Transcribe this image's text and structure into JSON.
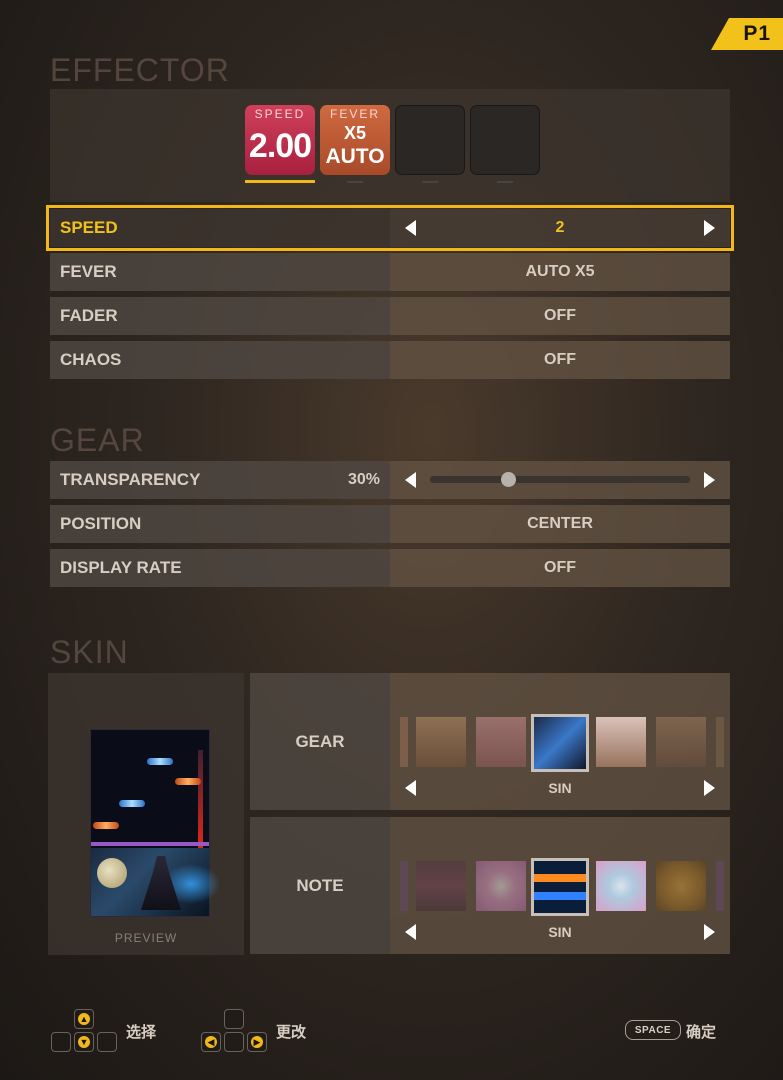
{
  "player_badge": "P1",
  "effector": {
    "title": "EFFECTOR",
    "slots": [
      {
        "top": "SPEED",
        "value": "2.00"
      },
      {
        "top": "FEVER",
        "x5": "X5",
        "auto": "AUTO"
      },
      {},
      {}
    ],
    "rows": [
      {
        "label": "SPEED",
        "value": "2"
      },
      {
        "label": "FEVER",
        "value": "AUTO X5"
      },
      {
        "label": "FADER",
        "value": "OFF"
      },
      {
        "label": "CHAOS",
        "value": "OFF"
      }
    ]
  },
  "gear": {
    "title": "GEAR",
    "transparency": {
      "label": "TRANSPARENCY",
      "value": "30%",
      "level": 0.3
    },
    "position": {
      "label": "POSITION",
      "value": "CENTER"
    },
    "display_rate": {
      "label": "DISPLAY RATE",
      "value": "OFF"
    }
  },
  "skin": {
    "title": "SKIN",
    "preview_label": "PREVIEW",
    "gear": {
      "label": "GEAR",
      "selected": "SIN"
    },
    "note": {
      "label": "NOTE",
      "selected": "SIN"
    }
  },
  "footer": {
    "select": "选择",
    "change": "更改",
    "space_key": "SPACE",
    "confirm": "确定"
  },
  "colors": {
    "accent": "#f2b71a",
    "speed_slot": "#c83050",
    "fever_slot": "#c05a34"
  }
}
